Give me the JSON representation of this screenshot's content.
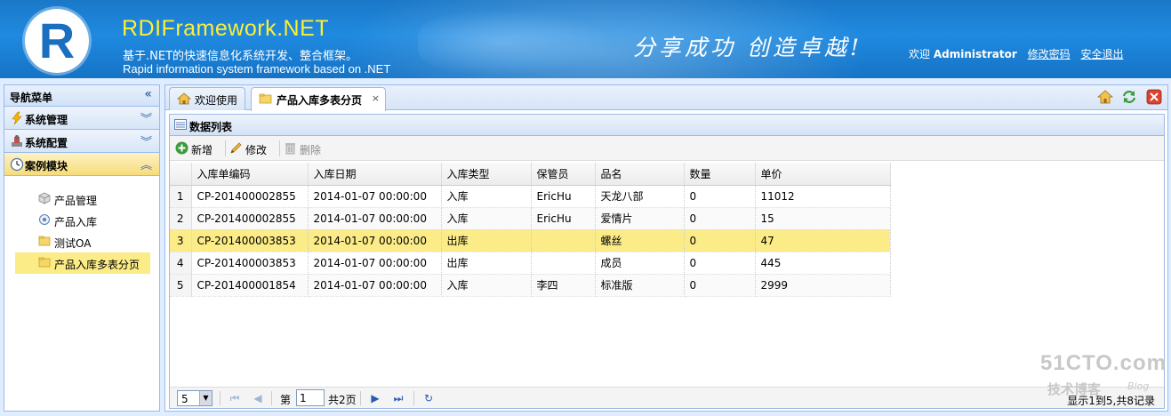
{
  "header": {
    "logo_letter": "R",
    "title": "RDIFramework.NET",
    "subtitle_cn": "基于.NET的快速信息化系统开发、整合框架。",
    "subtitle_en": "Rapid information system framework based on .NET",
    "slogan": "分享成功  创造卓越!",
    "welcome": "欢迎",
    "username": "Administrator",
    "change_password": "修改密码",
    "logout": "安全退出"
  },
  "sidebar": {
    "title": "导航菜单",
    "collapse_glyph": "«",
    "sections": [
      {
        "label": "系统管理",
        "icon": "lightning-icon"
      },
      {
        "label": "系统配置",
        "icon": "config-icon"
      },
      {
        "label": "案例模块",
        "icon": "clock-icon"
      }
    ],
    "items": [
      {
        "label": "产品管理",
        "icon": "box-icon"
      },
      {
        "label": "产品入库",
        "icon": "gear-icon"
      },
      {
        "label": "测试OA",
        "icon": "folder-icon"
      },
      {
        "label": "产品入库多表分页",
        "icon": "folder-icon"
      }
    ]
  },
  "tabs": [
    {
      "label": "欢迎使用",
      "icon": "home-icon"
    },
    {
      "label": "产品入库多表分页",
      "icon": "folder-icon",
      "close": "×"
    }
  ],
  "panel": {
    "title": "数据列表",
    "toolbar": {
      "add": "新增",
      "edit": "修改",
      "delete": "删除"
    }
  },
  "grid": {
    "columns": [
      "入库单编码",
      "入库日期",
      "入库类型",
      "保管员",
      "品名",
      "数量",
      "单价"
    ],
    "rows": [
      {
        "n": "1",
        "code": "CP-201400002855",
        "date": "2014-01-07 00:00:00",
        "type": "入库",
        "keeper": "EricHu",
        "name": "天龙八部",
        "qty": "0",
        "price": "11012"
      },
      {
        "n": "2",
        "code": "CP-201400002855",
        "date": "2014-01-07 00:00:00",
        "type": "入库",
        "keeper": "EricHu",
        "name": "爱情片",
        "qty": "0",
        "price": "15"
      },
      {
        "n": "3",
        "code": "CP-201400003853",
        "date": "2014-01-07 00:00:00",
        "type": "出库",
        "keeper": "",
        "name": "螺丝",
        "qty": "0",
        "price": "47"
      },
      {
        "n": "4",
        "code": "CP-201400003853",
        "date": "2014-01-07 00:00:00",
        "type": "出库",
        "keeper": "",
        "name": "成员",
        "qty": "0",
        "price": "445"
      },
      {
        "n": "5",
        "code": "CP-201400001854",
        "date": "2014-01-07 00:00:00",
        "type": "入库",
        "keeper": "李四",
        "name": "标准版",
        "qty": "0",
        "price": "2999"
      }
    ]
  },
  "pager": {
    "page_size": "5",
    "page_prefix": "第",
    "page_value": "1",
    "page_suffix": "共2页",
    "info": "显示1到5,共8记录"
  },
  "watermark": {
    "big": "51CTO.com",
    "small": "技术博客",
    "blog": "Blog"
  },
  "colors": {
    "header_blue": "#1f8ae0",
    "title_yellow": "#ffee33",
    "selected_row": "#fbec88",
    "border": "#99bbe8"
  }
}
